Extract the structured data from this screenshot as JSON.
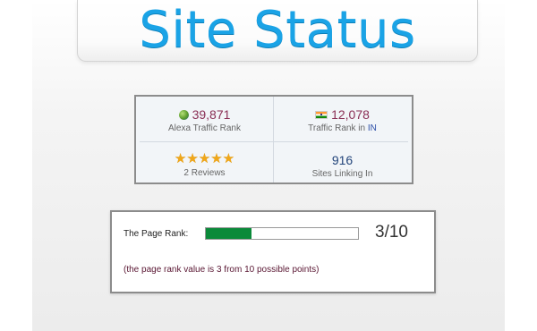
{
  "header": {
    "title": "Site Status"
  },
  "stats": {
    "alexa": {
      "icon": "globe-icon",
      "value": "39,871",
      "label": "Alexa Traffic Rank"
    },
    "country_rank": {
      "icon": "india-flag-icon",
      "value": "12,078",
      "label": "Traffic Rank in",
      "country_code": "IN"
    },
    "reviews": {
      "stars": 5,
      "label": "2 Reviews"
    },
    "links": {
      "value": "916",
      "label": "Sites Linking In"
    }
  },
  "pagerank": {
    "label": "The Page Rank:",
    "score": 3,
    "max": 10,
    "score_text": "3/10",
    "note": "(the page rank value is 3 from 10 possible points)"
  },
  "colors": {
    "title": "#1aa3e6",
    "rank_value": "#8a2f55",
    "bar_fill": "#0b8a3a",
    "star": "#f0a71a"
  }
}
